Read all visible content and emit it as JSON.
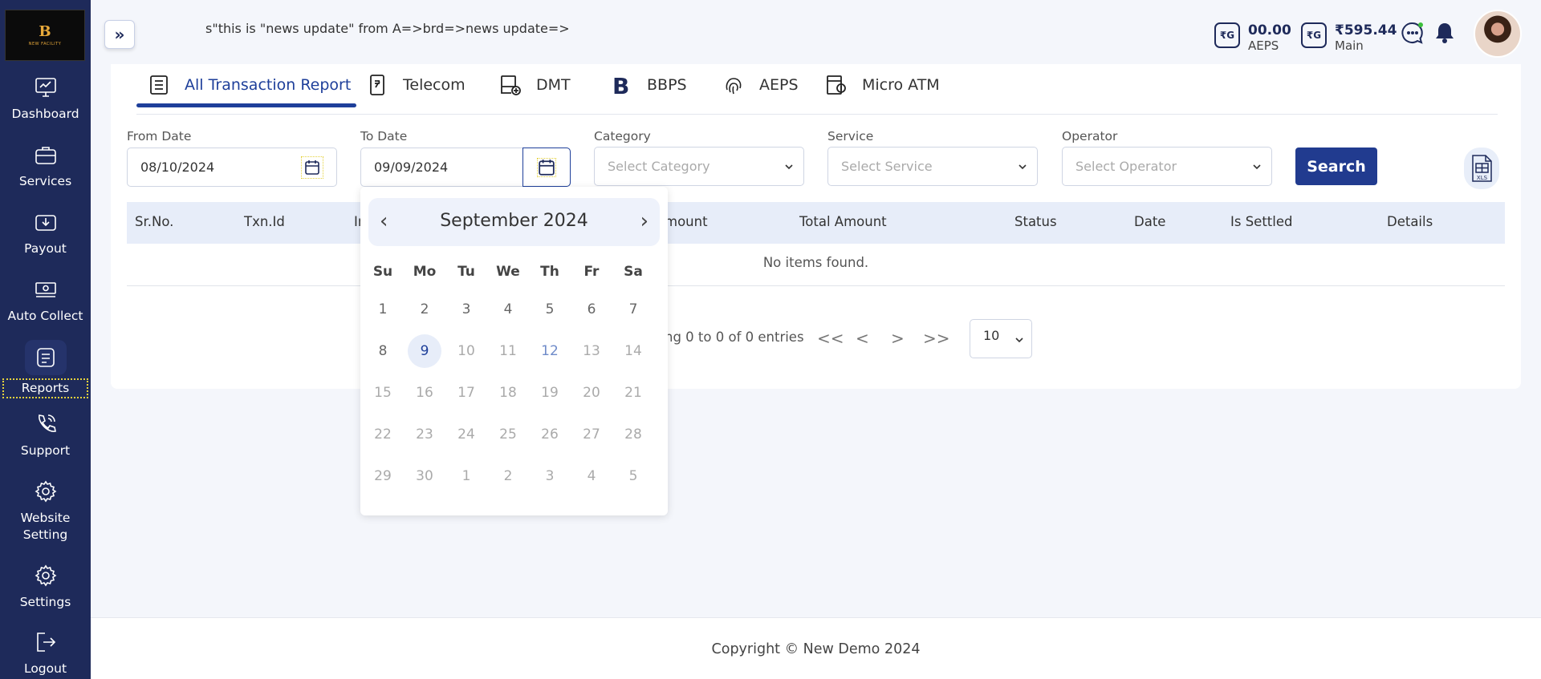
{
  "sidebar": {
    "logo_letter": "B",
    "logo_sub": "NEW FACILITY",
    "items": [
      {
        "label": "Dashboard"
      },
      {
        "label": "Services"
      },
      {
        "label": "Payout"
      },
      {
        "label": "Auto Collect"
      },
      {
        "label": "Reports"
      },
      {
        "label": "Support"
      },
      {
        "label": "Website Setting"
      },
      {
        "label": "Settings"
      },
      {
        "label": "Logout"
      }
    ]
  },
  "topbar": {
    "toggle": "»",
    "marquee": "s\"this is \"news update\" from A=>brd=>news update=>",
    "wallets": [
      {
        "icon": "₹G",
        "amount": "00.00",
        "label": "AEPS"
      },
      {
        "icon": "₹G",
        "amount": "₹595.44",
        "label": "Main"
      }
    ]
  },
  "tabs": [
    {
      "label": "All Transaction Report",
      "icon": "report-icon"
    },
    {
      "label": "Telecom",
      "icon": "phone-rupee-icon"
    },
    {
      "label": "DMT",
      "icon": "cash-register-icon"
    },
    {
      "label": "BBPS",
      "icon": "bbps-icon"
    },
    {
      "label": "AEPS",
      "icon": "fingerprint-icon"
    },
    {
      "label": "Micro ATM",
      "icon": "atm-icon"
    }
  ],
  "filters": {
    "from_date": {
      "label": "From Date",
      "value": "08/10/2024"
    },
    "to_date": {
      "label": "To Date",
      "value": "09/09/2024"
    },
    "category": {
      "label": "Category",
      "placeholder": "Select Category"
    },
    "service": {
      "label": "Service",
      "placeholder": "Select Service"
    },
    "operator": {
      "label": "Operator",
      "placeholder": "Select Operator"
    },
    "search_label": "Search",
    "xls_label": "XLS"
  },
  "table": {
    "columns": [
      "Sr.No.",
      "Txn.Id",
      "Ir",
      "mount",
      "Total Amount",
      "Status",
      "Date",
      "Is Settled",
      "Details"
    ],
    "empty_text": "No items found."
  },
  "pagination": {
    "entries_text": "ng 0 to 0 of 0 entries",
    "first": "<<",
    "prev": "<",
    "next": ">",
    "last": ">>",
    "page_size": "10"
  },
  "calendar": {
    "month_label": "September 2024",
    "weekdays": [
      "Su",
      "Mo",
      "Tu",
      "We",
      "Th",
      "Fr",
      "Sa"
    ],
    "weeks": [
      [
        "1",
        "2",
        "3",
        "4",
        "5",
        "6",
        "7"
      ],
      [
        "8",
        "9",
        "10",
        "11",
        "12",
        "13",
        "14"
      ],
      [
        "15",
        "16",
        "17",
        "18",
        "19",
        "20",
        "21"
      ],
      [
        "22",
        "23",
        "24",
        "25",
        "26",
        "27",
        "28"
      ],
      [
        "29",
        "30",
        "1",
        "2",
        "3",
        "4",
        "5"
      ]
    ],
    "selected": "9"
  },
  "footer": {
    "text": "Copyright © New Demo 2024"
  }
}
